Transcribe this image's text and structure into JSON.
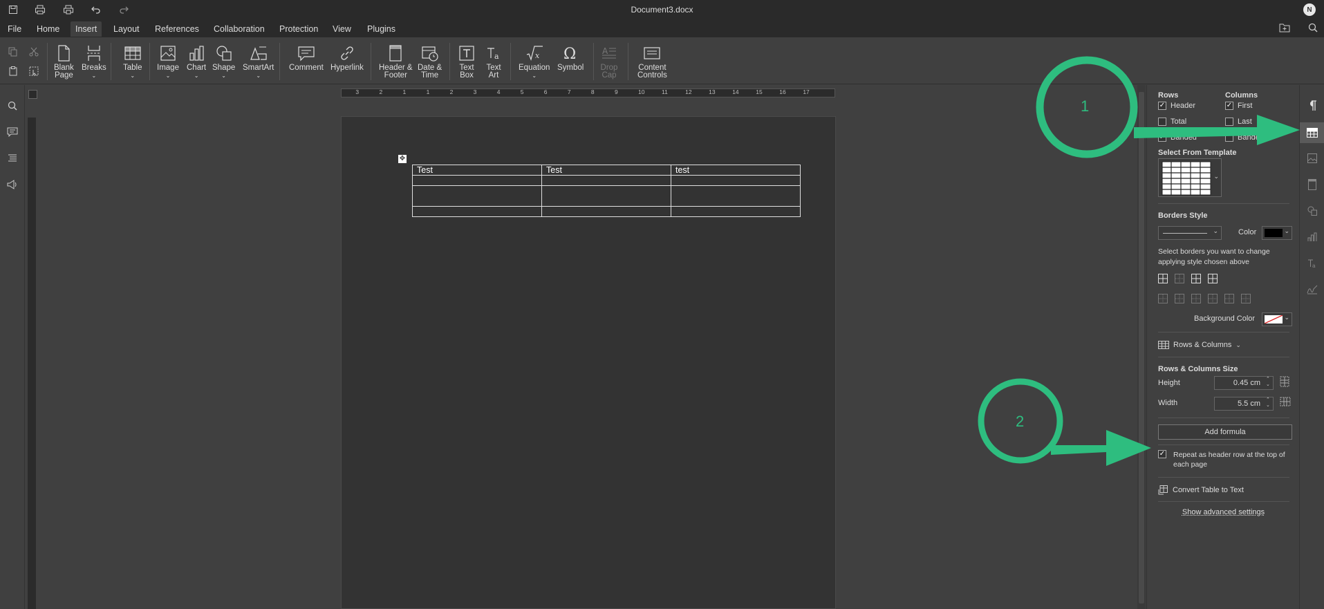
{
  "titlebar": {
    "title": "Document3.docx",
    "avatar_initial": "N",
    "icons": [
      "save-icon",
      "print-icon",
      "quick-print-icon",
      "undo-icon",
      "redo-icon",
      "open-location-icon",
      "search-icon"
    ]
  },
  "menu": {
    "items": [
      "File",
      "Home",
      "Insert",
      "Layout",
      "References",
      "Collaboration",
      "Protection",
      "View",
      "Plugins"
    ],
    "active": "Insert"
  },
  "toolbar": {
    "blank_page": [
      "Blank",
      "Page"
    ],
    "breaks": "Breaks",
    "table": "Table",
    "image": "Image",
    "chart": "Chart",
    "shape": "Shape",
    "smartart": "SmartArt",
    "comment": "Comment",
    "hyperlink": "Hyperlink",
    "header_footer": [
      "Header &",
      "Footer"
    ],
    "date_time": [
      "Date &",
      "Time"
    ],
    "text_box": [
      "Text",
      "Box"
    ],
    "text_art": [
      "Text",
      "Art"
    ],
    "equation": "Equation",
    "symbol": "Symbol",
    "drop_cap": [
      "Drop",
      "Cap"
    ],
    "content_controls": [
      "Content",
      "Controls"
    ]
  },
  "ruler": {
    "numbers": [
      "3",
      "2",
      "1",
      "1",
      "2",
      "3",
      "4",
      "5",
      "6",
      "7",
      "8",
      "9",
      "10",
      "11",
      "12",
      "13",
      "14",
      "15",
      "16",
      "17"
    ]
  },
  "document": {
    "table": [
      [
        "Test",
        "Test",
        "test"
      ],
      [
        "",
        "",
        ""
      ],
      [
        "",
        "",
        ""
      ],
      [
        "",
        "",
        ""
      ]
    ]
  },
  "right_panel": {
    "rows_label": "Rows",
    "columns_label": "Columns",
    "rows_options": [
      {
        "label": "Header",
        "checked": true
      },
      {
        "label": "Total",
        "checked": false
      },
      {
        "label": "Banded",
        "checked": true
      }
    ],
    "columns_options": [
      {
        "label": "First",
        "checked": true
      },
      {
        "label": "Last",
        "checked": false
      },
      {
        "label": "Banded",
        "checked": false
      }
    ],
    "template_label": "Select From Template",
    "borders_style_label": "Borders Style",
    "color_label": "Color",
    "border_color": "#000000",
    "borders_hint": "Select borders you want to change applying style chosen above",
    "background_color_label": "Background Color",
    "rows_columns_label": "Rows & Columns",
    "size_label": "Rows & Columns Size",
    "height_label": "Height",
    "height_value": "0.45 cm",
    "width_label": "Width",
    "width_value": "5.5 cm",
    "add_formula": "Add formula",
    "repeat_header": "Repeat as header row at the top of each page",
    "repeat_header_checked": true,
    "convert": "Convert Table to Text",
    "advanced": "Show advanced settings"
  },
  "annotations": {
    "marker1": "1",
    "marker2": "2",
    "color": "#2ebd7f"
  }
}
